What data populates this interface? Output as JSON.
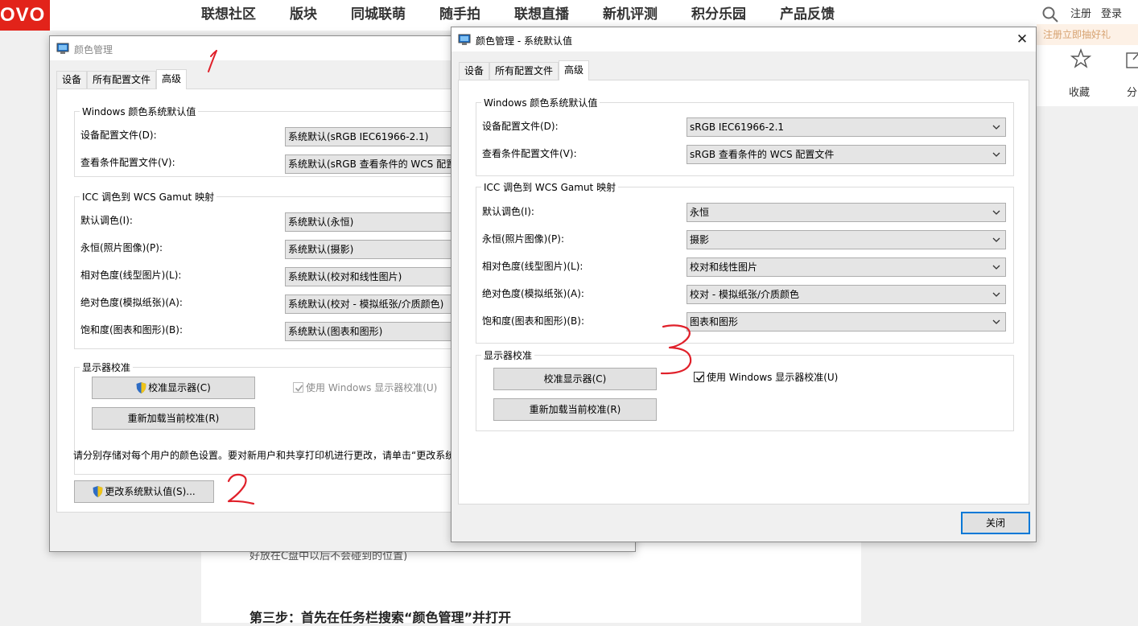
{
  "website": {
    "logo_text": "OVO",
    "nav": [
      "联想社区",
      "版块",
      "同城联萌",
      "随手拍",
      "联想直播",
      "新机评测",
      "积分乐园",
      "产品反馈"
    ],
    "links": [
      "注册",
      "登录"
    ],
    "promo": "注册立即抽好礼",
    "side": {
      "favorite": "收藏",
      "share": "分"
    },
    "article_cut": "好放在C盘中以后不会碰到的位置)",
    "article_step": "第三步：首先在任务栏搜索“颜色管理”并打开"
  },
  "dialog_back": {
    "title": "颜色管理",
    "tabs": [
      "设备",
      "所有配置文件",
      "高级"
    ],
    "windows_group": "Windows 颜色系统默认值",
    "rows_win": [
      {
        "label": "设备配置文件(D):",
        "value": "系统默认(sRGB IEC61966-2.1)"
      },
      {
        "label": "查看条件配置文件(V):",
        "value": "系统默认(sRGB 查看条件的 WCS 配置"
      }
    ],
    "icc_group": "ICC 调色到 WCS Gamut 映射",
    "rows_icc": [
      {
        "label": "默认调色(I):",
        "value": "系统默认(永恒)"
      },
      {
        "label": "永恒(照片图像)(P):",
        "value": "系统默认(摄影)"
      },
      {
        "label": "相对色度(线型图片)(L):",
        "value": "系统默认(校对和线性图片)"
      },
      {
        "label": "绝对色度(模拟纸张)(A):",
        "value": "系统默认(校对 - 模拟纸张/介质颜色)"
      },
      {
        "label": "饱和度(图表和图形)(B):",
        "value": "系统默认(图表和图形)"
      }
    ],
    "calib_group": "显示器校准",
    "calibrate_btn": "校准显示器(C)",
    "reload_btn": "重新加载当前校准(R)",
    "use_windows_calib": "使用 Windows 显示器校准(U)",
    "note": "请分别存储对每个用户的颜色设置。要对新用户和共享打印机进行更改，请单击“更改系统",
    "change_defaults_btn": "更改系统默认值(S)..."
  },
  "dialog_front": {
    "title": "颜色管理 - 系统默认值",
    "tabs": [
      "设备",
      "所有配置文件",
      "高级"
    ],
    "windows_group": "Windows 颜色系统默认值",
    "rows_win": [
      {
        "label": "设备配置文件(D):",
        "value": "sRGB IEC61966-2.1"
      },
      {
        "label": "查看条件配置文件(V):",
        "value": "sRGB 查看条件的 WCS 配置文件"
      }
    ],
    "icc_group": "ICC 调色到 WCS Gamut 映射",
    "rows_icc": [
      {
        "label": "默认调色(I):",
        "value": "永恒"
      },
      {
        "label": "永恒(照片图像)(P):",
        "value": "摄影"
      },
      {
        "label": "相对色度(线型图片)(L):",
        "value": "校对和线性图片"
      },
      {
        "label": "绝对色度(模拟纸张)(A):",
        "value": "校对 - 模拟纸张/介质颜色"
      },
      {
        "label": "饱和度(图表和图形)(B):",
        "value": "图表和图形"
      }
    ],
    "calib_group": "显示器校准",
    "calibrate_btn": "校准显示器(C)",
    "reload_btn": "重新加载当前校准(R)",
    "use_windows_calib": "使用 Windows 显示器校准(U)",
    "close_btn": "关闭"
  },
  "annotations": [
    "1",
    "2",
    "3"
  ],
  "colors": {
    "accent": "#0078d7",
    "brand": "#e2231a",
    "annotation": "#e0202a"
  }
}
